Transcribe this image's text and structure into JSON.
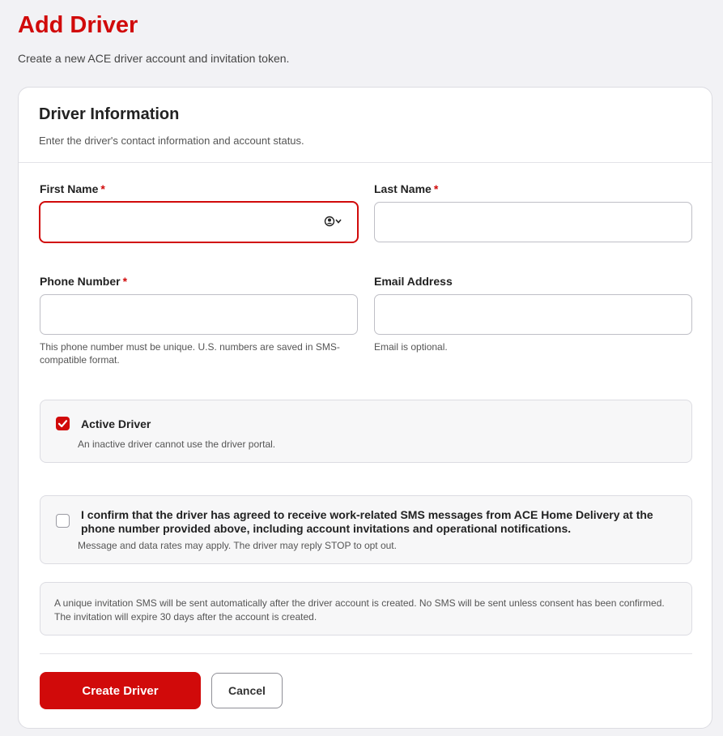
{
  "header": {
    "title": "Add Driver",
    "subtitle": "Create a new ACE driver account and invitation token."
  },
  "card": {
    "title": "Driver Information",
    "description": "Enter the driver's contact information and account status."
  },
  "fields": {
    "first_name": {
      "label": "First Name",
      "required_mark": "*",
      "value": "",
      "placeholder": ""
    },
    "last_name": {
      "label": "Last Name",
      "required_mark": "*",
      "value": "",
      "placeholder": ""
    },
    "phone": {
      "label": "Phone Number",
      "required_mark": "*",
      "value": "",
      "placeholder": "",
      "helper": "This phone number must be unique. U.S. numbers are saved in SMS-compatible format."
    },
    "email": {
      "label": "Email Address",
      "value": "",
      "placeholder": "",
      "helper": "Email is optional."
    }
  },
  "active_driver": {
    "label": "Active Driver",
    "description": "An inactive driver cannot use the driver portal.",
    "checked": true
  },
  "sms_consent": {
    "label": "I confirm that the driver has agreed to receive work-related SMS messages from ACE Home Delivery at the phone number provided above, including account invitations and operational notifications.",
    "description": "Message and data rates may apply. The driver may reply STOP to opt out.",
    "checked": false
  },
  "notice": "A unique invitation SMS will be sent automatically after the driver account is created. No SMS will be sent unless consent has been confirmed. The invitation will expire 30 days after the account is created.",
  "actions": {
    "create_label": "Create Driver",
    "cancel_label": "Cancel"
  },
  "colors": {
    "accent": "#d10a0a",
    "background": "#f2f2f5"
  },
  "icons": {
    "autofill": "contact-autofill-icon",
    "check": "checkmark-icon"
  }
}
